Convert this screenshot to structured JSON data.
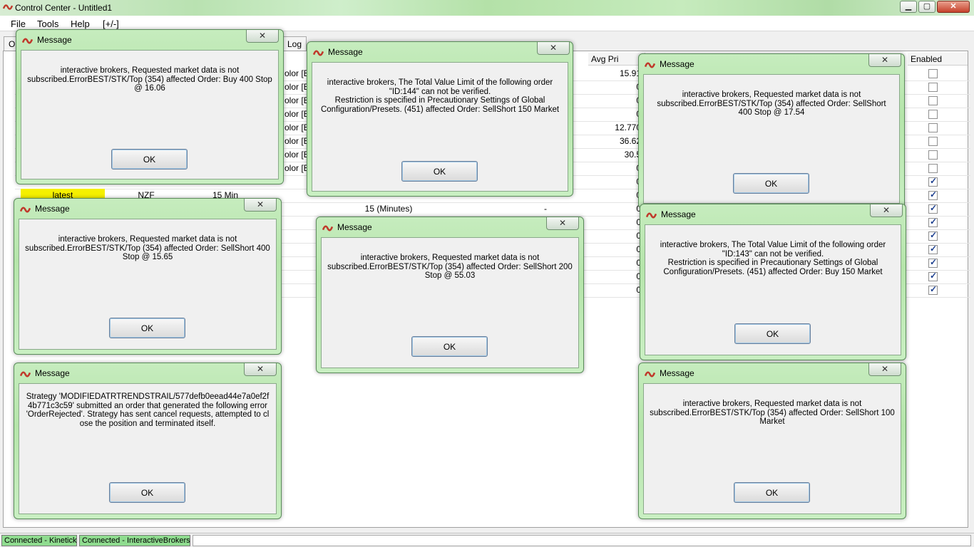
{
  "window": {
    "title": "Control Center - Untitled1",
    "controls": {
      "minimize": "▁",
      "maximize": "▢",
      "close": "✕"
    }
  },
  "menu": [
    "File",
    "Tools",
    "Help",
    "[+/-]"
  ],
  "tabs": [
    "Or",
    "Log"
  ],
  "grid": {
    "headers": {
      "avg_price": "Avg Pri",
      "enabled": "Enabled"
    },
    "color_cells": [
      "olor [B",
      "olor [B",
      "olor [B",
      "olor [B",
      "olor [B",
      "olor [B",
      "olor [B",
      "olor [B"
    ],
    "avg_prices": [
      "15.91",
      "0",
      "0",
      "0",
      "12.770",
      "36.62",
      "30.5",
      "0",
      "0",
      "0",
      "0",
      "0",
      "0",
      "0",
      "0",
      "0",
      "0"
    ],
    "enabled": [
      false,
      false,
      false,
      false,
      false,
      false,
      false,
      false,
      true,
      true,
      true,
      true,
      true,
      true,
      true,
      true,
      true
    ],
    "row_latest": {
      "label": "latest",
      "currency": "NZF",
      "interval": "15 Min"
    },
    "row_minutes": {
      "interval": "15 (Minutes)",
      "dash": "-"
    }
  },
  "status": [
    "Connected - Kinetick",
    "Connected - InteractiveBrokers"
  ],
  "dialog_title": "Message",
  "ok_label": "OK",
  "dialogs": [
    {
      "text": "interactive brokers, Requested market data is not subscribed.ErrorBEST/STK/Top (354) affected Order: Buy 400 Stop @ 16.06"
    },
    {
      "text": "interactive brokers, The Total Value Limit of the following order \"ID:144\" can not be verified.\nRestriction is specified in Precautionary Settings of Global Configuration/Presets. (451) affected Order: SellShort 150 Market"
    },
    {
      "text": "interactive brokers, Requested market data is not subscribed.ErrorBEST/STK/Top (354) affected Order: SellShort 400 Stop @ 17.54"
    },
    {
      "text": "interactive brokers, Requested market data is not subscribed.ErrorBEST/STK/Top (354) affected Order: SellShort 400 Stop @ 15.65"
    },
    {
      "text": "interactive brokers, Requested market data is not subscribed.ErrorBEST/STK/Top (354) affected Order: SellShort 200 Stop @ 55.03"
    },
    {
      "text": "interactive brokers, The Total Value Limit of the following order \"ID:143\" can not be verified.\nRestriction is specified in Precautionary Settings of Global Configuration/Presets. (451) affected Order: Buy 150 Market"
    },
    {
      "text": "Strategy 'MODIFIEDATRTRENDSTRAIL/577defb0eead44e7a0ef2f4b771c3c59' submitted an order that generated the following error 'OrderRejected'. Strategy has sent cancel requests, attempted to close the position and terminated itself."
    },
    {
      "text": "interactive brokers, Requested market data is not subscribed.ErrorBEST/STK/Top (354) affected Order: SellShort 100 Market"
    }
  ],
  "colors": {
    "status_green": "#8fdc8f",
    "highlight_yellow": "#f5f000",
    "dialog_green": "#b5e5aa"
  },
  "icons": {
    "app": "ninja-logo-icon",
    "close": "close-icon"
  }
}
